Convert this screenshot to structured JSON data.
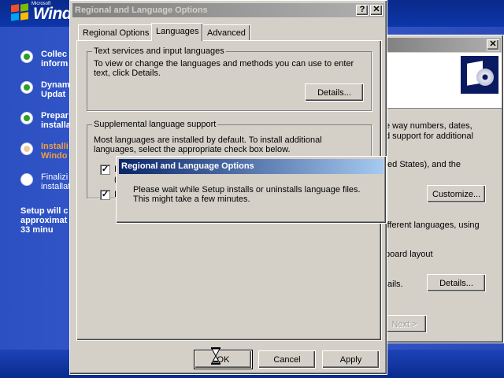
{
  "setup": {
    "logo_small": "Microsoft",
    "logo_text": "Windo",
    "steps": [
      {
        "label": "Collec\ninform",
        "state": "done"
      },
      {
        "label": "Dynam\nUpdat",
        "state": "done"
      },
      {
        "label": "Prepar\ninstalla",
        "state": "done"
      },
      {
        "label": "Installi\nWindo",
        "state": "current"
      },
      {
        "label": "Finalizi\ninstallat",
        "state": "pending"
      }
    ],
    "time_remaining": "Setup will c\napproximat\n33 minu",
    "colors": {
      "done": "#2aa02a",
      "current": "#f0a040",
      "pending": "#ffffff"
    }
  },
  "back_window": {
    "text_1": "e way numbers, dates,",
    "text_2": "d support for additional",
    "text_3": "ted States), and the",
    "customize_label": "Customize...",
    "text_4": "ifferent languages, using",
    "text_5": "board layout",
    "text_6": "tails.",
    "details_label": "Details...",
    "next_label": "Next >",
    "close_icon": "close-icon",
    "setup_icon": "cd-package-icon"
  },
  "main_dialog": {
    "title": "Regional and Language Options",
    "help_glyph": "?",
    "close_glyph": "✕",
    "tabs": [
      "Regional Options",
      "Languages",
      "Advanced"
    ],
    "selected_tab": 1,
    "text_services": {
      "title": "Text services and input languages",
      "description": "To view or change the languages and methods you can use to enter text, click Details.",
      "details_label": "Details..."
    },
    "supplemental": {
      "title": "Supplemental language support",
      "description": "Most languages are installed by default. To install additional languages, select the appropriate check box below.",
      "checkbox_1": {
        "label": "I",
        "checked": true,
        "sub": "("
      },
      "checkbox_2": {
        "label": "I",
        "checked": true
      }
    },
    "ok_label": "OK",
    "cancel_label": "Cancel",
    "apply_label": "Apply"
  },
  "progress_dialog": {
    "title": "Regional and Language Options",
    "message": "Please wait while Setup installs or uninstalls language files. This might take a few minutes."
  },
  "cursor": {
    "icon": "hourglass-icon"
  }
}
